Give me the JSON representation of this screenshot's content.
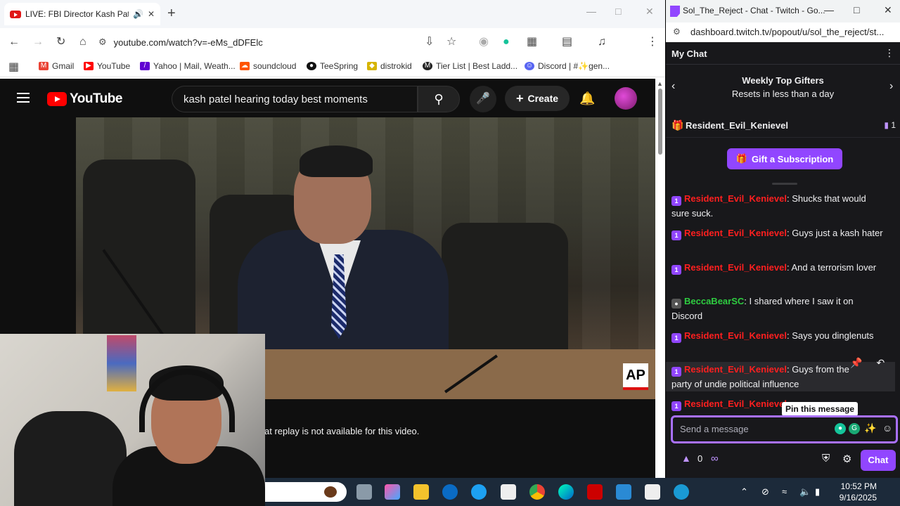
{
  "browser": {
    "tab_title": "LIVE: FBI Director Kash Pate",
    "url": "youtube.com/watch?v=-eMs_dDFElc",
    "bookmarks": [
      {
        "label": "Gmail",
        "color": "#ea4335"
      },
      {
        "label": "YouTube",
        "color": "#ff0000"
      },
      {
        "label": "Yahoo | Mail, Weath...",
        "color": "#6001d2"
      },
      {
        "label": "soundcloud",
        "color": "#ff5500"
      },
      {
        "label": "TeeSpring",
        "color": "#111111"
      },
      {
        "label": "distrokid",
        "color": "#d6b400"
      },
      {
        "label": "Tier List | Best Ladd...",
        "color": "#222222"
      },
      {
        "label": "Discord | #✨gen...",
        "color": "#5865f2"
      }
    ]
  },
  "youtube": {
    "logo": "YouTube",
    "search_value": "kash patel hearing today best moments",
    "create_label": "Create",
    "ap_label": "AP",
    "replay_note": "at replay is not available for this video."
  },
  "twitch": {
    "window_title": "Sol_The_Reject - Chat - Twitch - Go...",
    "url": "dashboard.twitch.tv/popout/u/sol_the_reject/st...",
    "header": "My Chat",
    "gifters_title": "Weekly Top Gifters",
    "gifters_sub": "Resets in less than a day",
    "top_gifter": "Resident_Evil_Kenievel",
    "top_gifter_count": "1",
    "gift_button": "Gift a Subscription",
    "messages": [
      {
        "user": "Resident_Evil_Kenievel",
        "color": "#ff1f1f",
        "badge": "1",
        "text": ": Shucks that would sure suck."
      },
      {
        "user": "Resident_Evil_Kenievel",
        "color": "#ff1f1f",
        "badge": "1",
        "text": ": Guys just a kash hater"
      },
      {
        "user": "Resident_Evil_Kenievel",
        "color": "#ff1f1f",
        "badge": "1",
        "text": ": And a terrorism lover"
      },
      {
        "user": "BeccaBearSC",
        "color": "#2ecc40",
        "badge": "bear",
        "text": ": I shared where I saw it on Discord"
      },
      {
        "user": "Resident_Evil_Kenievel",
        "color": "#ff1f1f",
        "badge": "1",
        "text": ": Says you dinglenuts"
      },
      {
        "user": "Resident_Evil_Kenievel",
        "color": "#ff1f1f",
        "badge": "1",
        "text": ": Guys from the party of undie political influence"
      },
      {
        "user": "Resident_Evil_Kenievel",
        "color": "#ff1f1f",
        "badge": "1",
        "text": ""
      }
    ],
    "tooltip": "Pin this message",
    "input_placeholder": "Send a message",
    "points": "0",
    "chat_button": "Chat"
  },
  "taskbar": {
    "time": "10:52 PM",
    "date": "9/16/2025"
  }
}
